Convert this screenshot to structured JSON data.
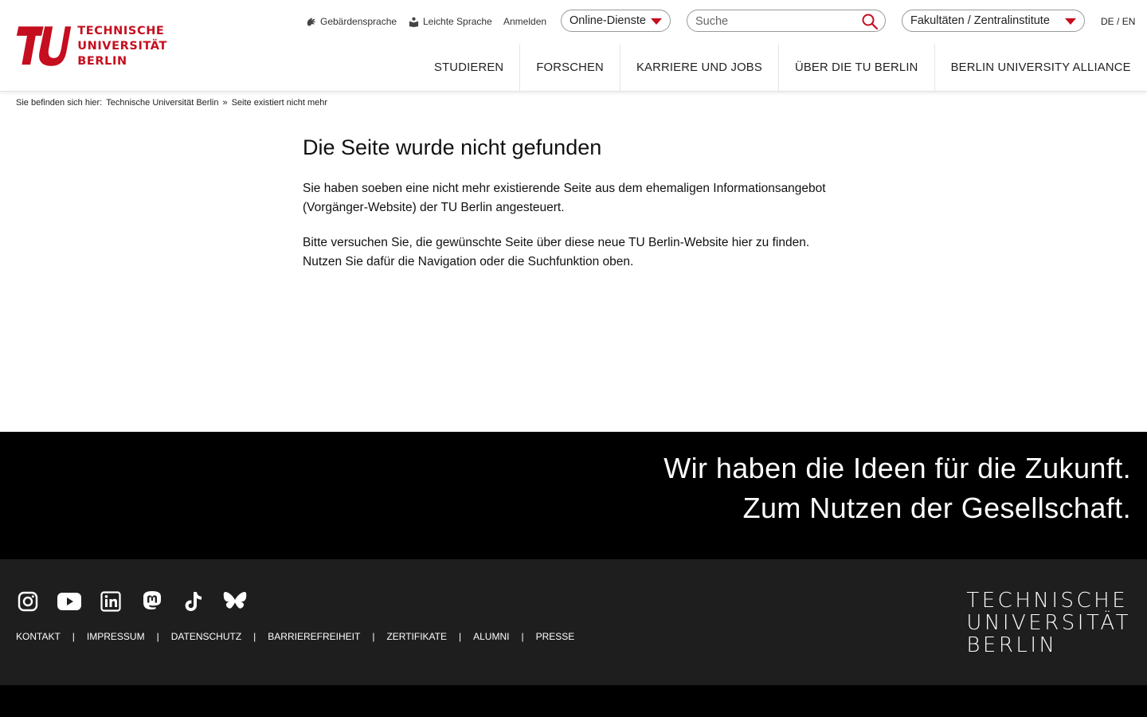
{
  "logo": {
    "line1": "TECHNISCHE",
    "line2": "UNIVERSITÄT",
    "line3": "BERLIN"
  },
  "utility": {
    "sign_language": "Gebärdensprache",
    "easy_language": "Leichte Sprache",
    "login": "Anmelden",
    "online_services": "Online-Dienste",
    "search_placeholder": "Suche",
    "faculties": "Fakultäten / Zentralinstitute",
    "lang_de": "DE",
    "lang_sep": "/",
    "lang_en": "EN"
  },
  "nav": {
    "items": [
      {
        "label": "STUDIEREN"
      },
      {
        "label": "FORSCHEN"
      },
      {
        "label": "KARRIERE UND JOBS"
      },
      {
        "label": "ÜBER DIE TU BERLIN"
      },
      {
        "label": "BERLIN UNIVERSITY ALLIANCE"
      }
    ]
  },
  "breadcrumb": {
    "prefix": "Sie befinden sich hier:",
    "home": "Technische Universität Berlin",
    "sep": "»",
    "current": "Seite existiert nicht mehr"
  },
  "content": {
    "title": "Die Seite wurde nicht gefunden",
    "p1": "Sie haben soeben eine nicht mehr existierende Seite aus dem ehemaligen Informationsangebot (Vorgänger-Website) der TU Berlin angesteuert.",
    "p2": "Bitte versuchen Sie, die gewünschte Seite über diese neue TU Berlin-Website hier zu finden. Nutzen Sie dafür die Navigation oder die Suchfunktion oben."
  },
  "claim": {
    "line1": "Wir haben die Ideen für die Zukunft.",
    "line2": "Zum Nutzen der Gesellschaft."
  },
  "footer": {
    "social": [
      "instagram-icon",
      "youtube-icon",
      "linkedin-icon",
      "mastodon-icon",
      "tiktok-icon",
      "bluesky-icon"
    ],
    "links": {
      "kontakt": "KONTAKT",
      "impressum": "IMPRESSUM",
      "datenschutz": "DATENSCHUTZ",
      "barrierefreiheit": "BARRIEREFREIHEIT",
      "zertifikate": "ZERTIFIKATE",
      "alumni": "ALUMNI",
      "presse": "PRESSE",
      "sep": "|"
    },
    "logo": {
      "line1": "TECHNISCHE",
      "line2": "UNIVERSITÄT",
      "line3": "BERLIN"
    }
  },
  "colors": {
    "brand_red": "#c50e1f",
    "footer_bg": "#1e1e1e",
    "claim_bg": "#000000"
  }
}
